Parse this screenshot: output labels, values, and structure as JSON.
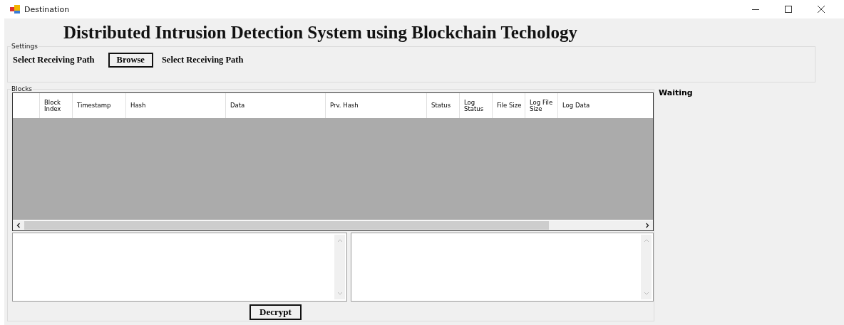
{
  "window": {
    "title": "Destination"
  },
  "heading": "Distributed Intrusion Detection System using Blockchain Techology",
  "settings": {
    "title": "Settings",
    "path_label": "Select Receiving Path",
    "browse_button": "Browse",
    "path_value": "Select Receiving Path"
  },
  "blocks": {
    "title": "Blocks",
    "columns": [
      "Block Index",
      "Timestamp",
      "Hash",
      "Data",
      "Prv. Hash",
      "Status",
      "Log Status",
      "File Size",
      "Log File Size",
      "Log Data"
    ]
  },
  "status_label": "Waiting",
  "decrypt_button": "Decrypt"
}
